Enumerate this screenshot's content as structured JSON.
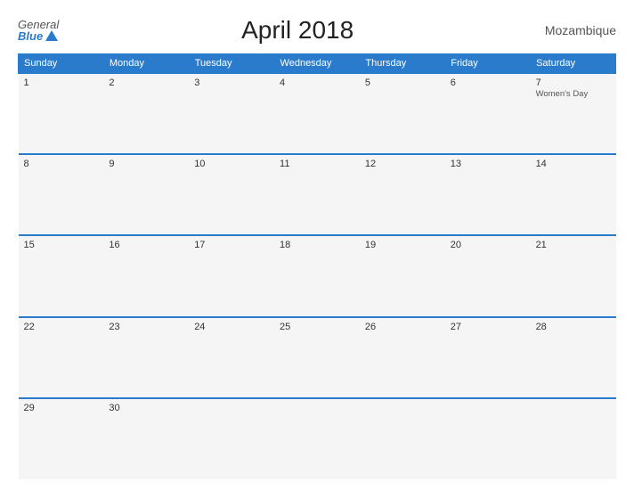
{
  "header": {
    "logo_general": "General",
    "logo_blue": "Blue",
    "title": "April 2018",
    "country": "Mozambique"
  },
  "weekdays": [
    "Sunday",
    "Monday",
    "Tuesday",
    "Wednesday",
    "Thursday",
    "Friday",
    "Saturday"
  ],
  "weeks": [
    [
      {
        "day": "1",
        "event": ""
      },
      {
        "day": "2",
        "event": ""
      },
      {
        "day": "3",
        "event": ""
      },
      {
        "day": "4",
        "event": ""
      },
      {
        "day": "5",
        "event": ""
      },
      {
        "day": "6",
        "event": ""
      },
      {
        "day": "7",
        "event": "Women's Day"
      }
    ],
    [
      {
        "day": "8",
        "event": ""
      },
      {
        "day": "9",
        "event": ""
      },
      {
        "day": "10",
        "event": ""
      },
      {
        "day": "11",
        "event": ""
      },
      {
        "day": "12",
        "event": ""
      },
      {
        "day": "13",
        "event": ""
      },
      {
        "day": "14",
        "event": ""
      }
    ],
    [
      {
        "day": "15",
        "event": ""
      },
      {
        "day": "16",
        "event": ""
      },
      {
        "day": "17",
        "event": ""
      },
      {
        "day": "18",
        "event": ""
      },
      {
        "day": "19",
        "event": ""
      },
      {
        "day": "20",
        "event": ""
      },
      {
        "day": "21",
        "event": ""
      }
    ],
    [
      {
        "day": "22",
        "event": ""
      },
      {
        "day": "23",
        "event": ""
      },
      {
        "day": "24",
        "event": ""
      },
      {
        "day": "25",
        "event": ""
      },
      {
        "day": "26",
        "event": ""
      },
      {
        "day": "27",
        "event": ""
      },
      {
        "day": "28",
        "event": ""
      }
    ],
    [
      {
        "day": "29",
        "event": ""
      },
      {
        "day": "30",
        "event": ""
      },
      {
        "day": "",
        "event": ""
      },
      {
        "day": "",
        "event": ""
      },
      {
        "day": "",
        "event": ""
      },
      {
        "day": "",
        "event": ""
      },
      {
        "day": "",
        "event": ""
      }
    ]
  ]
}
